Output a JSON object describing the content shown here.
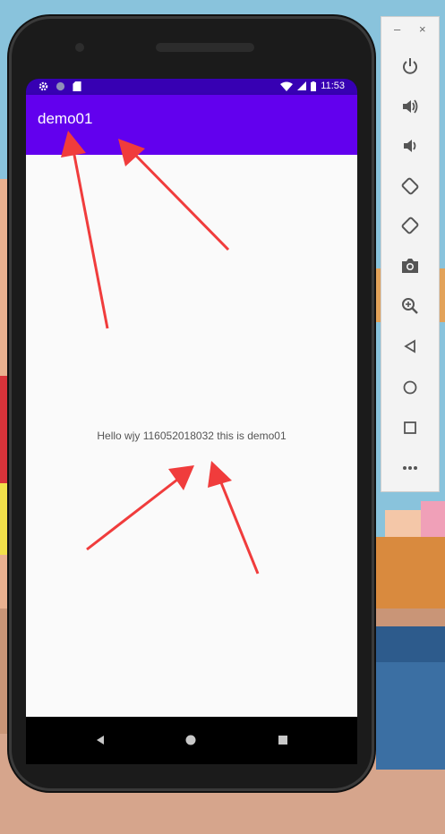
{
  "status_bar": {
    "time": "11:53"
  },
  "app_bar": {
    "title": "demo01"
  },
  "content": {
    "message": "Hello wjy 116052018032 this is demo01"
  },
  "emulator_panel": {
    "window_controls": {
      "minimize": "–",
      "close": "×"
    },
    "tools": [
      "power-icon",
      "volume-up-icon",
      "volume-down-icon",
      "rotate-left-icon",
      "rotate-right-icon",
      "screenshot-icon",
      "zoom-icon",
      "back-icon",
      "home-icon",
      "overview-icon",
      "more-icon"
    ]
  },
  "colors": {
    "status_bar": "#3700b3",
    "app_bar": "#6200ee",
    "content_bg": "#fafafa",
    "annotation_arrow": "#f03c3c"
  }
}
